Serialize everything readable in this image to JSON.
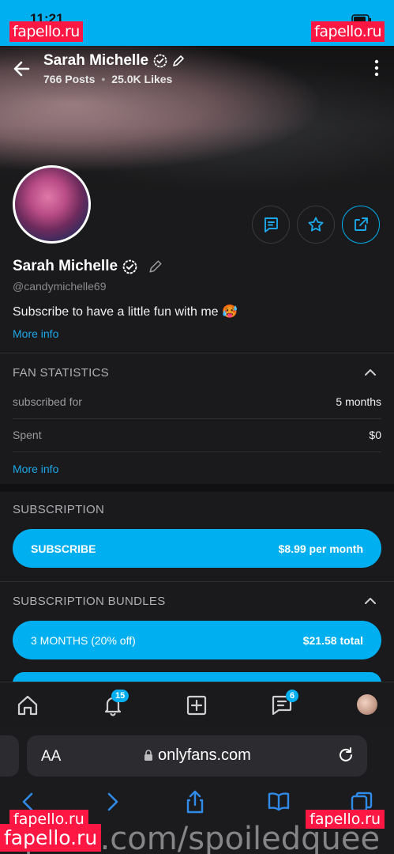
{
  "status": {
    "time": "11:21"
  },
  "watermarks": {
    "site": "fapello.ru",
    "footer_text": "fapello.com/spoiledquee"
  },
  "header": {
    "name": "Sarah Michelle",
    "posts": "766 Posts",
    "likes": "25.0K Likes"
  },
  "profile": {
    "name": "Sarah Michelle",
    "handle": "@candymichelle69",
    "bio": "Subscribe to have a little fun with me 🥵",
    "more_info": "More info"
  },
  "fan_stats": {
    "title": "FAN STATISTICS",
    "rows": [
      {
        "label": "subscribed for",
        "value": "5 months"
      },
      {
        "label": "Spent",
        "value": "$0"
      }
    ],
    "more_info": "More info"
  },
  "subscription": {
    "title": "SUBSCRIPTION",
    "button_label": "SUBSCRIBE",
    "price": "$8.99 per month"
  },
  "bundles": {
    "title": "SUBSCRIPTION BUNDLES",
    "items": [
      {
        "label": "3 MONTHS (20% off)",
        "price": "$21.58 total"
      }
    ]
  },
  "tabbar": {
    "notifications_badge": "15",
    "messages_badge": "6"
  },
  "browser": {
    "aa": "AA",
    "url": "onlyfans.com"
  },
  "colors": {
    "accent": "#00aff0",
    "background": "#1a1a1c",
    "watermark": "#ff1744"
  }
}
